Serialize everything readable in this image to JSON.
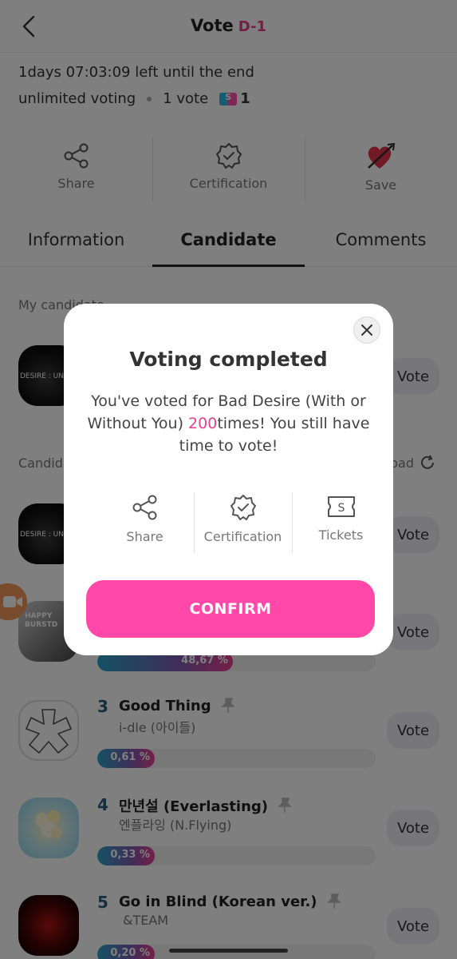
{
  "header": {
    "title": "Vote",
    "dday": "D-1"
  },
  "info": {
    "time_left": "1days 07:03:09 left until the end",
    "voting_mode": "unlimited voting",
    "vote_cost": "1 vote",
    "ticket_count": "1"
  },
  "actions": [
    {
      "label": "Share",
      "icon": "share-icon"
    },
    {
      "label": "Certification",
      "icon": "certification-badge-icon"
    },
    {
      "label": "Save",
      "icon": "heart-arrow-icon"
    }
  ],
  "tabs": [
    {
      "label": "Information",
      "active": false
    },
    {
      "label": "Candidate",
      "active": true
    },
    {
      "label": "Comments",
      "active": false
    }
  ],
  "sections": {
    "my_candidate": "My candidate",
    "candidates": "Candida",
    "reload": "oad"
  },
  "my_candidate": {
    "thumb_text": "DESIRE : UNLE",
    "vote_label": "Vote"
  },
  "candidates": [
    {
      "thumb_text": "DESIRE : UNLE",
      "vote_label": "Vote"
    },
    {
      "thumb_text": "HAPPY BURSTD",
      "vote_label": "Vote",
      "percent": "48,67 %",
      "percent_value": 48.67
    },
    {
      "rank": "3",
      "title": "Good Thing",
      "artist": "i-dle (아이들)",
      "vote_label": "Vote",
      "percent": "0,61 %",
      "percent_value": 0.61
    },
    {
      "rank": "4",
      "title": "만년설 (Everlasting)",
      "artist": "엔플라잉 (N.Flying)",
      "vote_label": "Vote",
      "percent": "0,33 %",
      "percent_value": 0.33
    },
    {
      "rank": "5",
      "title": "Go in Blind (Korean ver.)",
      "artist": "&TEAM",
      "vote_label": "Vote",
      "percent": "0,20 %",
      "percent_value": 0.2
    }
  ],
  "modal": {
    "title": "Voting completed",
    "message_prefix": "You've voted for  Bad Desire (With or Without You) ",
    "message_count": "200",
    "message_suffix": "times! You still have time to vote!",
    "actions": [
      {
        "label": "Share",
        "icon": "share-icon"
      },
      {
        "label": "Certification",
        "icon": "certification-badge-icon"
      },
      {
        "label": "Tickets",
        "icon": "ticket-icon"
      }
    ],
    "confirm_label": "CONFIRM"
  },
  "colors": {
    "accent": "#ff48a8",
    "dday": "#e43d8d",
    "rank": "#2a5e7b"
  }
}
